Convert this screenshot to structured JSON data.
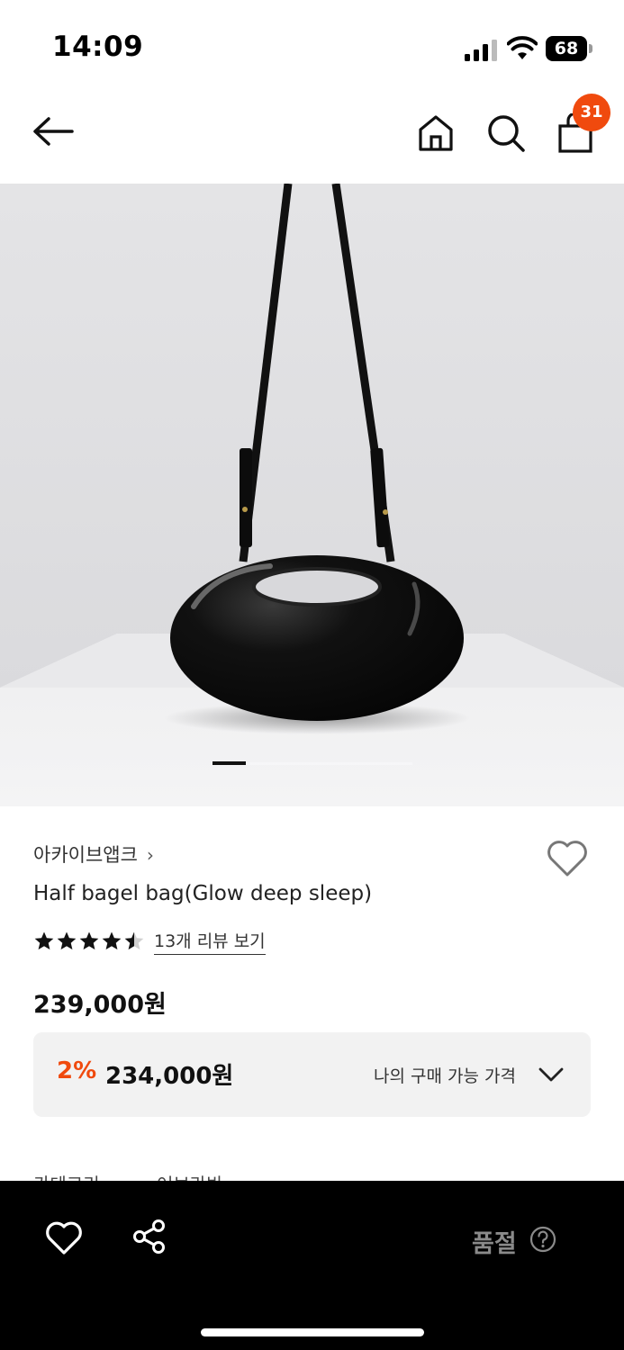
{
  "status_bar": {
    "time": "14:09",
    "battery": "68"
  },
  "header": {
    "back_icon": "arrow-left-icon",
    "home_icon": "home-icon",
    "search_icon": "search-icon",
    "cart_icon": "shopping-bag-icon",
    "cart_count": "31",
    "badge_color": "#f04a0e"
  },
  "gallery": {
    "current_slide": 1
  },
  "product": {
    "brand": "아카이브앱크",
    "brand_chevron": "›",
    "name": "Half bagel bag(Glow deep sleep)",
    "rating": 4.5,
    "review_link": "13개 리뷰 보기",
    "price": "239,000원"
  },
  "price_box": {
    "discount_rate": "2%",
    "discount_price": "234,000원",
    "toggle_label": "나의 구매 가능 가격",
    "discount_color": "#f04a0e"
  },
  "sections_peek": {
    "left": "카테고리",
    "right": "어브라반"
  },
  "bottom_bar": {
    "like_icon": "heart-icon",
    "share_icon": "share-icon",
    "status_label": "품절",
    "help_icon": "help-circle-icon"
  }
}
